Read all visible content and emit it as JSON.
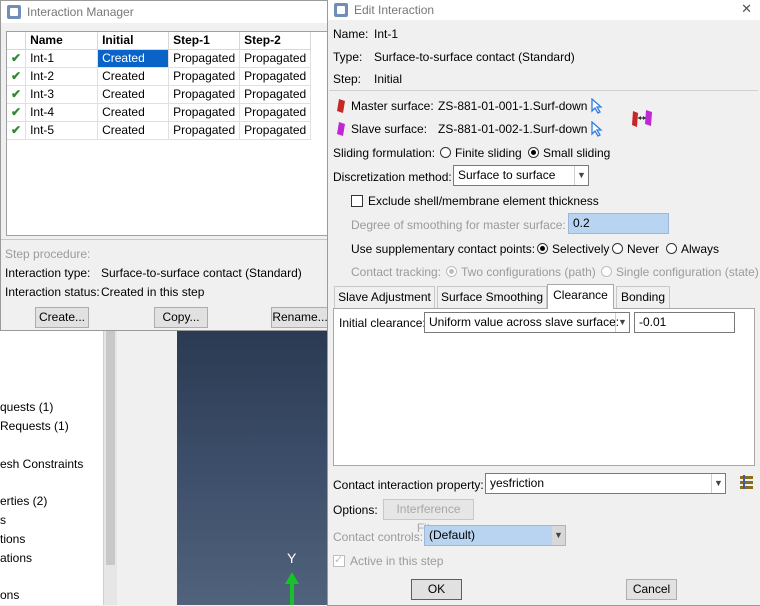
{
  "background_tree": {
    "items": [
      "quests (1)",
      "Requests (1)",
      "esh Constraints",
      "erties (2)",
      "s",
      "tions",
      "ations",
      "ons"
    ]
  },
  "viewport": {
    "axis_label": "Y"
  },
  "interaction_manager": {
    "title": "Interaction Manager",
    "columns": [
      "Name",
      "Initial",
      "Step-1",
      "Step-2"
    ],
    "rows": [
      {
        "name": "Int-1",
        "initial": "Created",
        "step1": "Propagated",
        "step2": "Propagated"
      },
      {
        "name": "Int-2",
        "initial": "Created",
        "step1": "Propagated",
        "step2": "Propagated"
      },
      {
        "name": "Int-3",
        "initial": "Created",
        "step1": "Propagated",
        "step2": "Propagated"
      },
      {
        "name": "Int-4",
        "initial": "Created",
        "step1": "Propagated",
        "step2": "Propagated"
      },
      {
        "name": "Int-5",
        "initial": "Created",
        "step1": "Propagated",
        "step2": "Propagated"
      }
    ],
    "step_procedure_label": "Step procedure:",
    "interaction_type_label": "Interaction type:",
    "interaction_type_value": "Surface-to-surface contact (Standard)",
    "interaction_status_label": "Interaction status:",
    "interaction_status_value": "Created in this step",
    "buttons": {
      "create": "Create...",
      "copy": "Copy...",
      "rename": "Rename..."
    }
  },
  "edit_interaction": {
    "title": "Edit Interaction",
    "close_glyph": "✕",
    "name_label": "Name:",
    "name_value": "Int-1",
    "type_label": "Type:",
    "type_value": "Surface-to-surface contact (Standard)",
    "step_label": "Step:",
    "step_value": "Initial",
    "master_label": "Master surface:",
    "master_value": "ZS-881-01-001-1.Surf-down",
    "slave_label": "Slave surface:",
    "slave_value": "ZS-881-01-002-1.Surf-down",
    "sliding_label": "Sliding formulation:",
    "sliding_finite": "Finite sliding",
    "sliding_small": "Small sliding",
    "discretization_label": "Discretization method:",
    "discretization_value": "Surface to surface",
    "exclude_shell": "Exclude shell/membrane element thickness",
    "smoothing_label": "Degree of smoothing for master surface:",
    "smoothing_value": "0.2",
    "supp_label": "Use supplementary contact points:",
    "supp_selectively": "Selectively",
    "supp_never": "Never",
    "supp_always": "Always",
    "tracking_label": "Contact tracking:",
    "tracking_two": "Two configurations (path)",
    "tracking_single": "Single configuration (state)",
    "tabs": [
      "Slave Adjustment",
      "Surface Smoothing",
      "Clearance",
      "Bonding"
    ],
    "clearance_label": "Initial clearance:",
    "clearance_method": "Uniform value across slave surface:",
    "clearance_value": "-0.01",
    "property_label": "Contact interaction property:",
    "property_value": "yesfriction",
    "options_label": "Options:",
    "options_button": "Interference Fit...",
    "controls_label": "Contact controls:",
    "controls_value": "(Default)",
    "active_label": "Active in this step",
    "ok": "OK",
    "cancel": "Cancel"
  },
  "colors": {
    "selection": "#0a64c8",
    "master_marker": "#c62828",
    "slave_marker": "#c026d3",
    "cursor": "#2f7de1"
  }
}
